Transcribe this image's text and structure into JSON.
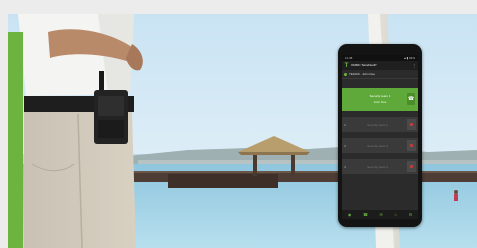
{
  "image": {
    "description_colors": {
      "accent": "#6db33f",
      "sky": "#c7e0f0",
      "sea": "#a4d3e6"
    }
  },
  "phone": {
    "status_left": "11:48",
    "status_right": "▲▮ 92%",
    "app_title": "OMMC TetraFlexIP",
    "kebab": "⋮",
    "user_line": "TE1000 · John Doe",
    "active_call": {
      "line1": "Security team 1",
      "line2": "John Doe",
      "button_icon": "☎"
    },
    "slots": [
      {
        "num": "2",
        "label": "Security team 2"
      },
      {
        "num": "3",
        "label": "Security team 3"
      },
      {
        "num": "4",
        "label": "Security team 4"
      }
    ],
    "nav_icons": [
      "◉",
      "☎",
      "✉",
      "⌂",
      "⚙"
    ]
  }
}
